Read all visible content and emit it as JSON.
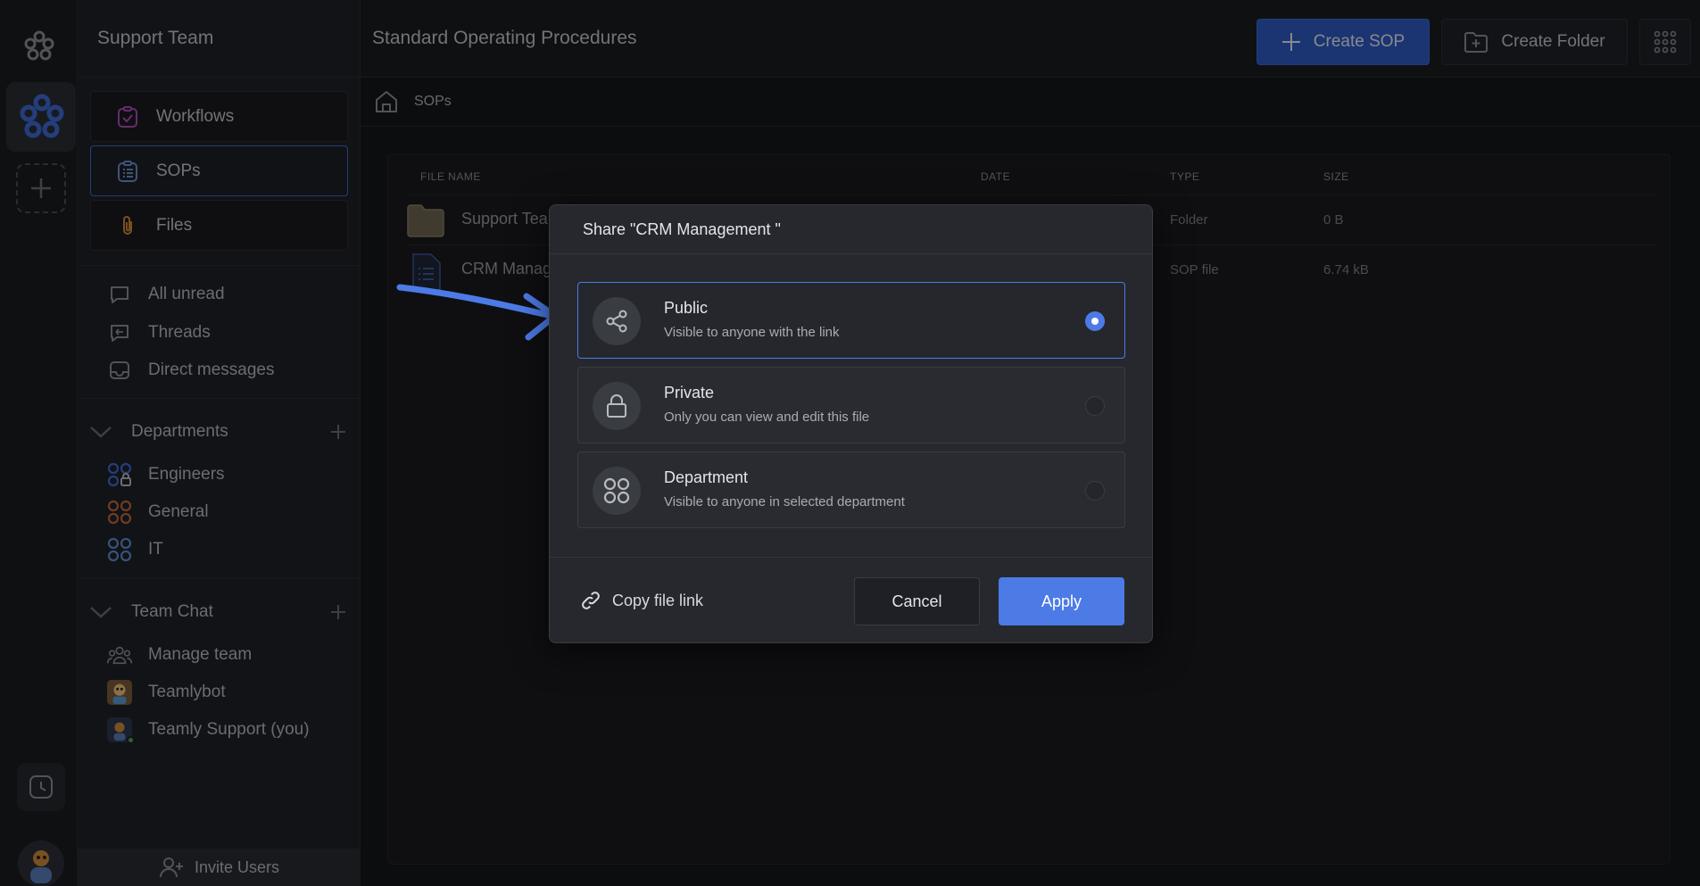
{
  "sidebar": {
    "workspace_title": "Support Team",
    "nav": [
      {
        "label": "Workflows",
        "icon": "clipboard-check-icon"
      },
      {
        "label": "SOPs",
        "icon": "clipboard-list-icon"
      },
      {
        "label": "Files",
        "icon": "paperclip-icon"
      }
    ],
    "inbox": [
      {
        "label": "All unread",
        "icon": "chat-bubble-icon"
      },
      {
        "label": "Threads",
        "icon": "threads-icon"
      },
      {
        "label": "Direct messages",
        "icon": "inbox-icon"
      }
    ],
    "departments_label": "Departments",
    "departments": [
      {
        "label": "Engineers",
        "color": "#3f6bd6"
      },
      {
        "label": "General",
        "color": "#c0693b"
      },
      {
        "label": "IT",
        "color": "#5b8fd6"
      }
    ],
    "team_chat_label": "Team Chat",
    "team_chat": [
      {
        "label": "Manage team",
        "icon": "team-icon"
      },
      {
        "label": "Teamlybot",
        "icon": "bot-avatar"
      },
      {
        "label": "Teamly Support (you)",
        "icon": "user-avatar"
      }
    ],
    "invite_label": "Invite Users"
  },
  "header": {
    "title": "Standard Operating Procedures",
    "create_sop_label": "Create SOP",
    "create_folder_label": "Create Folder"
  },
  "breadcrumb": {
    "current": "SOPs"
  },
  "table": {
    "columns": [
      "FILE NAME",
      "DATE",
      "TYPE",
      "SIZE"
    ],
    "rows": [
      {
        "name": "Support Tea",
        "date": "",
        "type": "Folder",
        "size": "0 B",
        "icon": "folder-icon"
      },
      {
        "name": "CRM Manag",
        "date": "",
        "type": "SOP file",
        "size": "6.74 kB",
        "icon": "document-icon"
      }
    ]
  },
  "modal": {
    "title": "Share \"CRM Management \"",
    "options": [
      {
        "title": "Public",
        "desc": "Visible to anyone with the link",
        "icon": "share-icon",
        "selected": true
      },
      {
        "title": "Private",
        "desc": "Only you can view and edit this file",
        "icon": "lock-icon",
        "selected": false
      },
      {
        "title": "Department",
        "desc": "Visible to anyone in selected department",
        "icon": "department-icon",
        "selected": false
      }
    ],
    "copy_link_label": "Copy file link",
    "cancel_label": "Cancel",
    "apply_label": "Apply"
  },
  "colors": {
    "accent": "#4c7be6",
    "primary_button": "#2f5bc4"
  }
}
